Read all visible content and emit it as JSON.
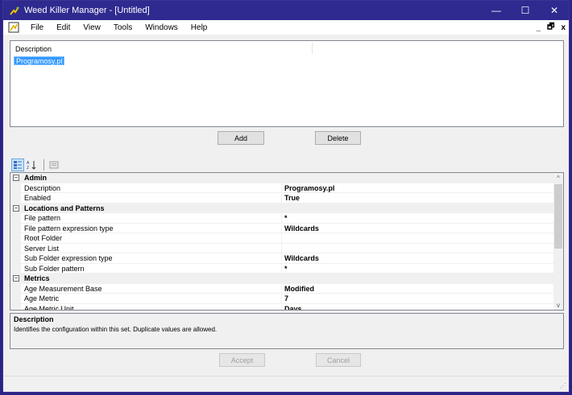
{
  "window": {
    "title": "Weed Killer Manager - [Untitled]",
    "minimize": "—",
    "maximize": "☐",
    "close": "✕"
  },
  "menu": {
    "items": [
      "File",
      "Edit",
      "View",
      "Tools",
      "Windows",
      "Help"
    ],
    "mdi_minimize": "_",
    "mdi_restore": "🗗",
    "mdi_close": "x"
  },
  "list": {
    "column": "Description",
    "rows": [
      "Programosy.pl"
    ]
  },
  "buttons": {
    "add": "Add",
    "delete": "Delete",
    "accept": "Accept",
    "cancel": "Cancel"
  },
  "toolbar": {
    "sort_alpha_label": "AZ"
  },
  "properties": {
    "categories": [
      {
        "name": "Admin",
        "items": [
          {
            "name": "Description",
            "value": "Programosy.pl"
          },
          {
            "name": "Enabled",
            "value": "True"
          }
        ]
      },
      {
        "name": "Locations and Patterns",
        "items": [
          {
            "name": "File pattern",
            "value": "*"
          },
          {
            "name": "File pattern expression type",
            "value": "Wildcards"
          },
          {
            "name": "Root Folder",
            "value": ""
          },
          {
            "name": "Server List",
            "value": ""
          },
          {
            "name": "Sub Folder expression type",
            "value": "Wildcards"
          },
          {
            "name": "Sub Folder pattern",
            "value": "*"
          }
        ]
      },
      {
        "name": "Metrics",
        "items": [
          {
            "name": "Age Measurement Base",
            "value": "Modified"
          },
          {
            "name": "Age Metric",
            "value": "7"
          },
          {
            "name": "Age Metric Unit",
            "value": "Days"
          }
        ]
      }
    ],
    "expander": "−"
  },
  "help": {
    "title": "Description",
    "text": "Identifies the configuration within this set.  Duplicate values are allowed."
  },
  "scroll": {
    "up": "^",
    "down": "v"
  },
  "colors": {
    "titlebar": "#2e2a8f",
    "selection": "#3399ff"
  }
}
